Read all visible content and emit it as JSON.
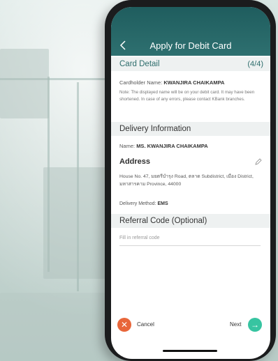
{
  "header": {
    "title": "Apply for Debit Card",
    "back_icon": "chevron-left-icon"
  },
  "card_detail": {
    "title": "Card Detail",
    "step": "(4/4)",
    "cardholder_label": "Cardholder Name: ",
    "cardholder_value": "KWANJIRA CHAIKAMPA",
    "note": "Note: The displayed name will be on your debit card. It may have been shortened. In case of any errors, please contact KBank branches."
  },
  "delivery": {
    "title": "Delivery Information",
    "name_label": "Name: ",
    "name_value": "MS. KWANJIRA CHAIKAMPA",
    "address_title": "Address",
    "address_text": "House No. 47, มยตรีบำรุง Road, ตลาด Subdistrict, เมือง District, มหาสารคาม Province, 44000",
    "method_label": "Delivery Method: ",
    "method_value": "EMS",
    "edit_icon": "pencil-icon"
  },
  "referral": {
    "title": "Referral Code (Optional)",
    "placeholder": "Fill in referral code"
  },
  "footer": {
    "cancel_label": "Cancel",
    "cancel_icon": "close-icon",
    "next_label": "Next",
    "next_icon": "arrow-right-icon"
  },
  "colors": {
    "header": "#1f5d5e",
    "accent_teal": "#2d6d6c",
    "cancel": "#e8663a",
    "next": "#37c4a1"
  }
}
